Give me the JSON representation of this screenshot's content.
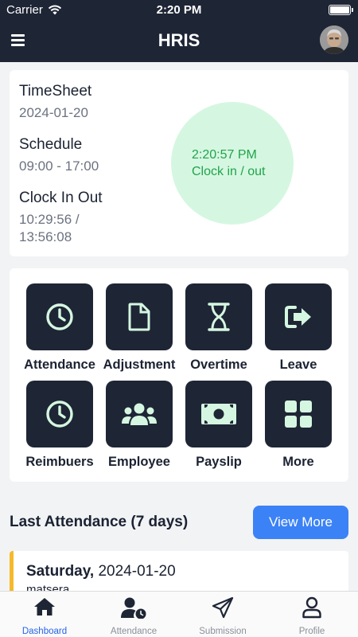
{
  "status_bar": {
    "carrier": "Carrier",
    "time": "2:20 PM"
  },
  "header": {
    "title": "HRIS"
  },
  "timesheet": {
    "title": "TimeSheet",
    "date": "2024-01-20",
    "schedule_label": "Schedule",
    "schedule_value": "09:00 - 17:00",
    "clock_label": "Clock In Out",
    "clock_in": "10:29:56 /",
    "clock_out": "13:56:08",
    "current_time": "2:20:57 PM",
    "clock_action": "Clock in / out"
  },
  "menu": {
    "items": [
      {
        "label": "Attendance",
        "icon": "clock-icon"
      },
      {
        "label": "Adjustment",
        "icon": "document-icon"
      },
      {
        "label": "Overtime",
        "icon": "hourglass-icon"
      },
      {
        "label": "Leave",
        "icon": "exit-icon"
      },
      {
        "label": "Reimbuers",
        "icon": "clock-icon"
      },
      {
        "label": "Employee",
        "icon": "users-icon"
      },
      {
        "label": "Payslip",
        "icon": "money-icon"
      },
      {
        "label": "More",
        "icon": "grid-icon"
      }
    ]
  },
  "last_attendance": {
    "title": "Last Attendance (7 days)",
    "view_more": "View More",
    "entries": [
      {
        "day": "Saturday,",
        "date": "2024-01-20",
        "sub": "matsera"
      }
    ]
  },
  "tabs": [
    {
      "label": "Dashboard",
      "icon": "home-icon",
      "active": true
    },
    {
      "label": "Attendance",
      "icon": "user-clock-icon",
      "active": false
    },
    {
      "label": "Submission",
      "icon": "paper-plane-icon",
      "active": false
    },
    {
      "label": "Profile",
      "icon": "user-icon",
      "active": false
    }
  ],
  "colors": {
    "header_bg": "#1e2535",
    "accent": "#3b82f6",
    "clock_bg": "#d5f7e1",
    "clock_text": "#22a34a",
    "icon_tint": "#d5f7e1",
    "attendance_marker": "#f5b92a"
  }
}
